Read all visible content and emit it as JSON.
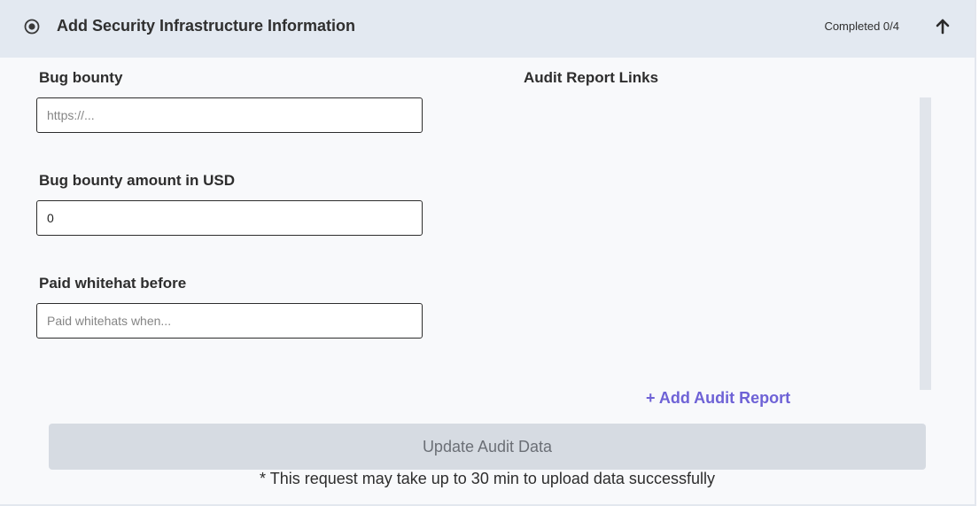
{
  "header": {
    "title": "Add Security Infrastructure Information",
    "completed": "Completed 0/4",
    "status_icon": "radio-selected-icon",
    "collapse_icon": "arrow-up-icon"
  },
  "form": {
    "bug_bounty": {
      "label": "Bug bounty",
      "value": "",
      "placeholder": "https://..."
    },
    "bug_bounty_amount": {
      "label": "Bug bounty amount in USD",
      "value": "0",
      "placeholder": ""
    },
    "paid_whitehat": {
      "label": "Paid whitehat before",
      "value": "",
      "placeholder": "Paid whitehats when..."
    }
  },
  "audit": {
    "title": "Audit Report Links",
    "add_label": "+ Add Audit Report"
  },
  "actions": {
    "update_label": "Update Audit Data",
    "note": "* This request may take up to 30 min to upload data successfully"
  },
  "colors": {
    "header_bg": "#e3e9f1",
    "panel_bg": "#f8f9fb",
    "accent": "#6e62d6",
    "button_bg": "#d6dbe2"
  }
}
